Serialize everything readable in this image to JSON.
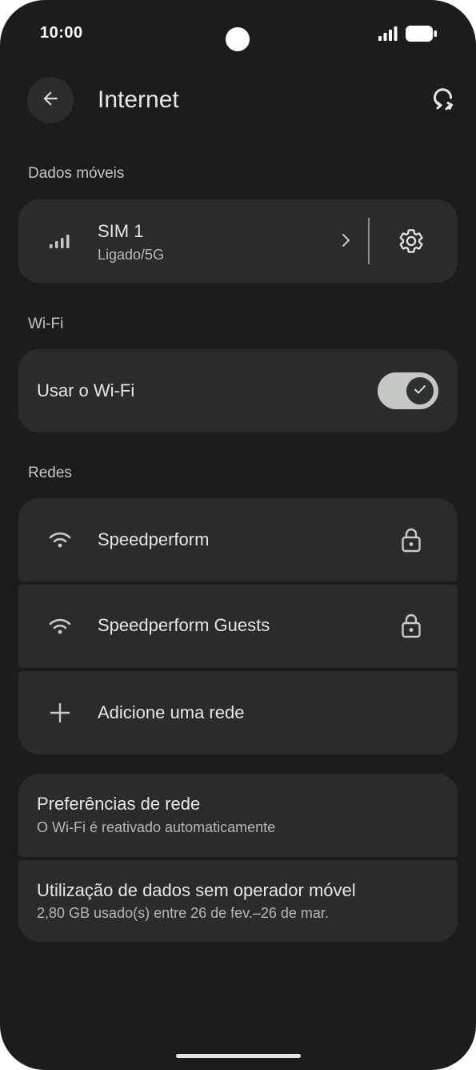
{
  "status_bar": {
    "time": "10:00"
  },
  "header": {
    "title": "Internet"
  },
  "mobile_data": {
    "section_label": "Dados móveis",
    "sim": {
      "name": "SIM 1",
      "status": "Ligado/5G"
    }
  },
  "wifi": {
    "section_label": "Wi-Fi",
    "toggle_label": "Usar o Wi-Fi",
    "enabled": true
  },
  "networks": {
    "section_label": "Redes",
    "items": [
      {
        "ssid": "Speedperform",
        "secured": true,
        "icon": "wifi-icon"
      },
      {
        "ssid": "Speedperform Guests",
        "secured": true,
        "icon": "wifi-icon"
      }
    ],
    "add_label": "Adicione uma rede"
  },
  "preferences": {
    "title": "Preferências de rede",
    "subtitle": "O Wi-Fi é reativado automaticamente"
  },
  "data_usage": {
    "title": "Utilização de dados sem operador móvel",
    "subtitle": "2,80 GB usado(s) entre 26 de fev.–26 de mar."
  },
  "colors": {
    "background": "#1b1c1b",
    "card": "#2b2c2a",
    "text_primary": "#e6e6e4",
    "text_secondary": "#b6b8b4",
    "toggle_track": "#c4c8c3"
  }
}
